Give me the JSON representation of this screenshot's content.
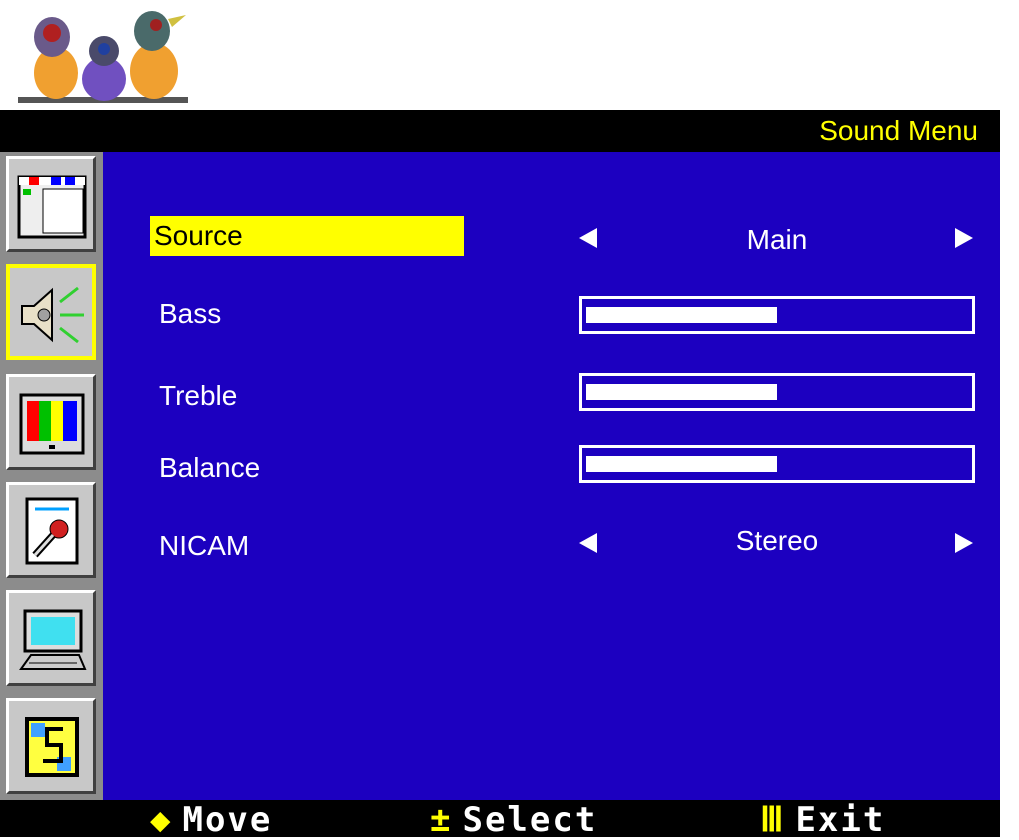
{
  "header": {
    "title": "Sound Menu"
  },
  "sidebar": {
    "items": [
      {
        "name": "picture",
        "icon": "window-icon",
        "active": false
      },
      {
        "name": "sound",
        "icon": "speaker-icon",
        "active": true
      },
      {
        "name": "color",
        "icon": "color-bars-icon",
        "active": false
      },
      {
        "name": "setup",
        "icon": "wrench-icon",
        "active": false
      },
      {
        "name": "pc",
        "icon": "computer-icon",
        "active": false
      },
      {
        "name": "info",
        "icon": "info-s-icon",
        "active": false
      }
    ]
  },
  "menu": {
    "source": {
      "label": "Source",
      "value": "Main"
    },
    "bass": {
      "label": "Bass",
      "level": 0.5
    },
    "treble": {
      "label": "Treble",
      "level": 0.5
    },
    "balance": {
      "label": "Balance",
      "level": 0.5
    },
    "nicam": {
      "label": "NICAM",
      "value": "Stereo"
    }
  },
  "footer": {
    "move_icon": "◆",
    "move_label": "Move",
    "select_icon": "±",
    "select_label": "Select",
    "exit_icon": "Ⅲ",
    "exit_label": "Exit"
  },
  "colors": {
    "background": "#1c00c0",
    "accent": "#ffff00",
    "text": "#ffffff",
    "titlebar": "#000000"
  }
}
